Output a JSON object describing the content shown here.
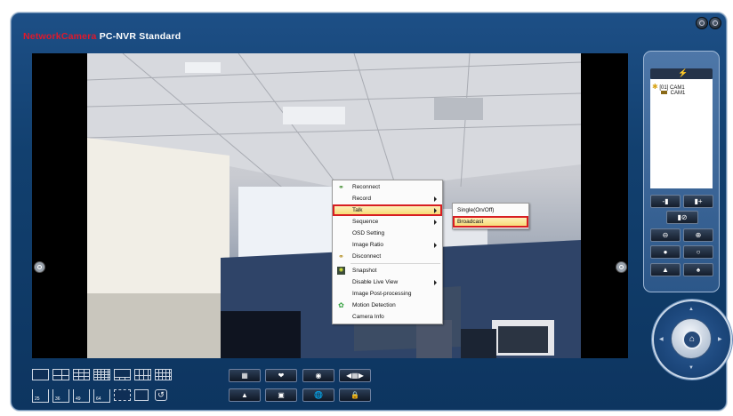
{
  "app": {
    "brand_red": "NetworkCamera",
    "brand_white": "PC-NVR Standard",
    "colors": {
      "accent_red": "#e0182b",
      "frame_blue": "#12406f",
      "highlight": "#f6d76a",
      "outline_red": "#d81e22"
    }
  },
  "context_menu": {
    "items": [
      {
        "label": "Reconnect",
        "icon": "link-icon",
        "submenu": false
      },
      {
        "label": "Record",
        "icon": "",
        "submenu": true
      },
      {
        "label": "Talk",
        "icon": "",
        "submenu": true,
        "highlighted": true
      },
      {
        "label": "Sequence",
        "icon": "",
        "submenu": true
      },
      {
        "label": "OSD Setting",
        "icon": "",
        "submenu": false
      },
      {
        "label": "Image Ratio",
        "icon": "",
        "submenu": true
      },
      {
        "label": "Disconnect",
        "icon": "broken-link-icon",
        "submenu": false
      },
      {
        "label": "Snapshot",
        "icon": "camera-icon",
        "submenu": false
      },
      {
        "label": "Disable Live View",
        "icon": "",
        "submenu": true
      },
      {
        "label": "Image Post-processing",
        "icon": "",
        "submenu": false
      },
      {
        "label": "Motion Detection",
        "icon": "motion-icon",
        "submenu": false
      },
      {
        "label": "Camera Info",
        "icon": "",
        "submenu": false
      }
    ]
  },
  "talk_submenu": {
    "items": [
      {
        "label": "Single(On/Off)"
      },
      {
        "label": "Broadcast",
        "highlighted": true
      }
    ]
  },
  "camera_tree": {
    "root": "[01] CAM1",
    "child": "CAM1"
  },
  "layout_labels": [
    "25",
    "36",
    "49",
    "64"
  ]
}
